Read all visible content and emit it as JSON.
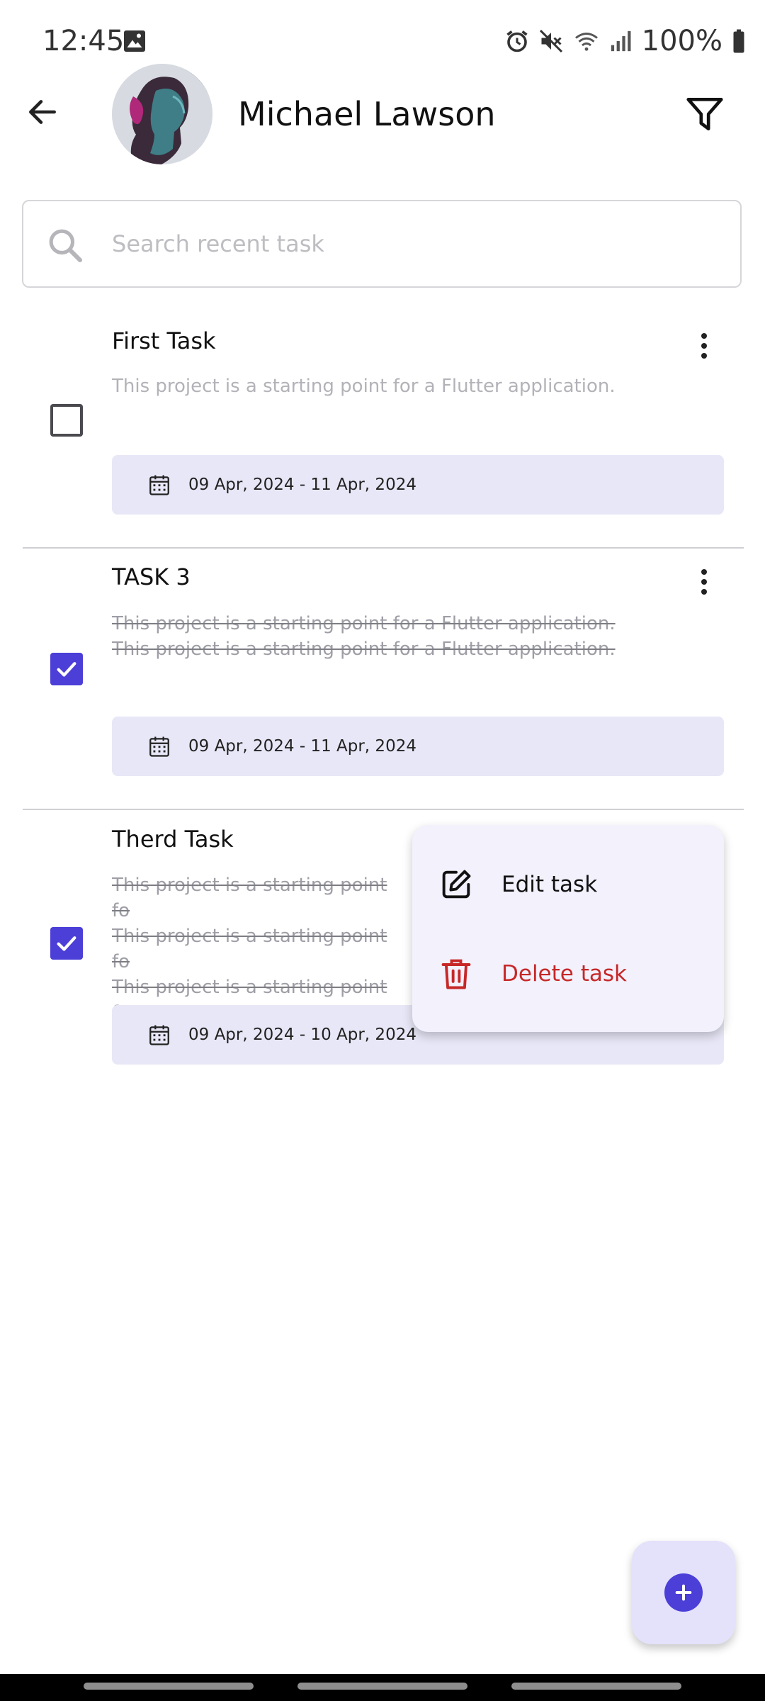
{
  "status_bar": {
    "time": "12:45",
    "battery": "100%",
    "icons": [
      "gallery-icon",
      "alarm-icon",
      "mute-icon",
      "wifi-icon",
      "signal-icon",
      "battery-icon"
    ]
  },
  "header": {
    "user_name": "Michael Lawson",
    "icons": [
      "back-arrow-icon",
      "avatar",
      "filter-icon"
    ]
  },
  "search": {
    "placeholder": "Search recent task",
    "value": ""
  },
  "tasks": [
    {
      "title": "First Task",
      "description": "This project is a starting point for a Flutter application.",
      "completed": false,
      "date_range": "09 Apr, 2024 - 11 Apr, 2024"
    },
    {
      "title": "TASK 3",
      "description": "This project is a starting point for a Flutter application.\nThis project is a starting point for a Flutter application.",
      "completed": true,
      "date_range": "09 Apr, 2024 - 11 Apr, 2024"
    },
    {
      "title": "Therd Task",
      "description": "This project is a starting point fo\nThis project is a starting point fo\nThis project is a starting point fo",
      "completed": true,
      "date_range": "09 Apr, 2024 - 10 Apr, 2024"
    }
  ],
  "popup_menu": {
    "edit_label": "Edit task",
    "delete_label": "Delete task"
  },
  "colors": {
    "accent": "#4b3fd8",
    "date_bar_bg": "#e8e7f7",
    "delete_red": "#c62828",
    "menu_bg": "#f2f1fc",
    "fab_bg": "#e4e1fb"
  }
}
